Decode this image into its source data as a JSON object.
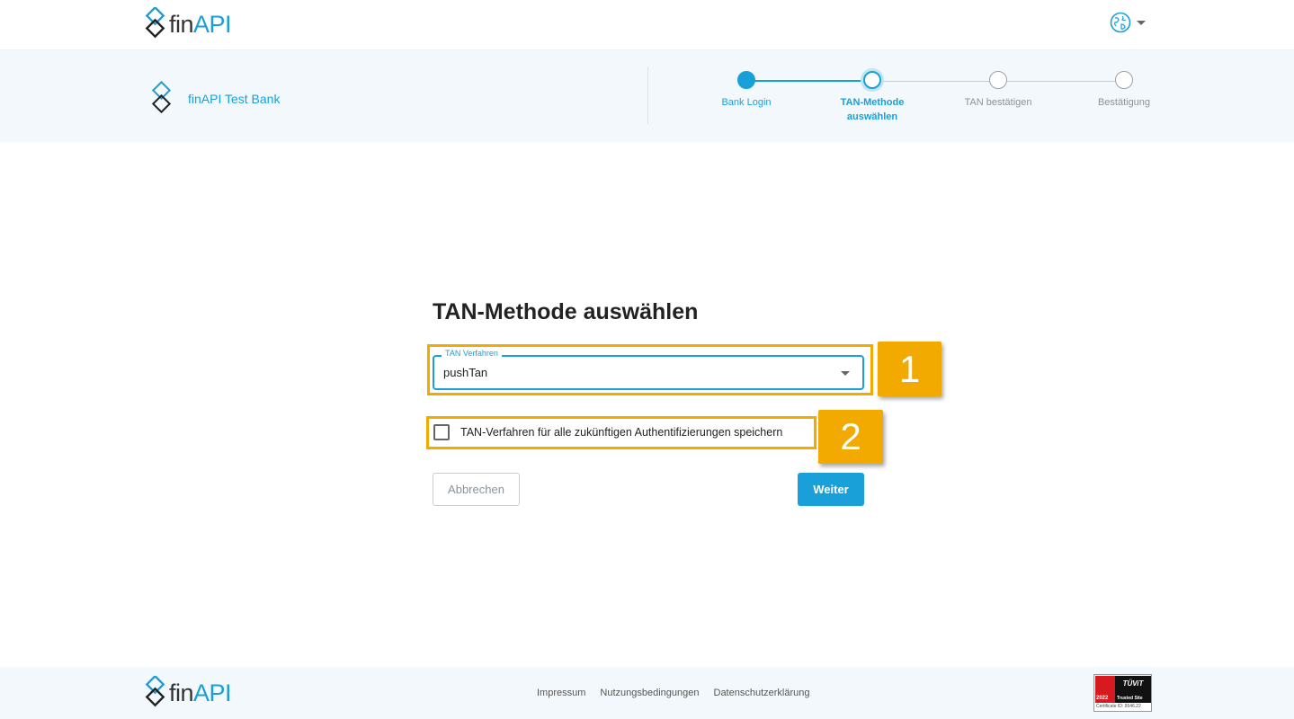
{
  "header": {
    "logo": {
      "fin": "fin",
      "api": "API"
    },
    "language_icon": "globe-icon"
  },
  "bank": {
    "name": "finAPI Test Bank"
  },
  "stepper": {
    "steps": [
      {
        "label": "Bank Login",
        "state": "done"
      },
      {
        "label": "TAN-Methode auswählen",
        "state": "active"
      },
      {
        "label": "TAN bestätigen",
        "state": "pending"
      },
      {
        "label": "Bestätigung",
        "state": "pending"
      }
    ]
  },
  "main": {
    "title": "TAN-Methode auswählen",
    "tan_select": {
      "label": "TAN Verfahren",
      "value": "pushTan"
    },
    "save_checkbox": {
      "label": "TAN-Verfahren für alle zukünftigen Authentifizierungen speichern",
      "checked": false
    },
    "cancel_label": "Abbrechen",
    "next_label": "Weiter"
  },
  "annotations": {
    "badge1": "1",
    "badge2": "2"
  },
  "footer": {
    "logo": {
      "fin": "fin",
      "api": "API"
    },
    "links": [
      "Impressum",
      "Nutzungsbedingungen",
      "Datenschutzerklärung"
    ],
    "tuv": {
      "brand": "TÜViT",
      "year": "2022",
      "label": "Trusted Site",
      "cert": "Certificate ID: 9546.22"
    }
  },
  "colors": {
    "accent": "#1aa0d8",
    "highlight": "#f2a900",
    "bar_background": "#f2f8fc"
  }
}
